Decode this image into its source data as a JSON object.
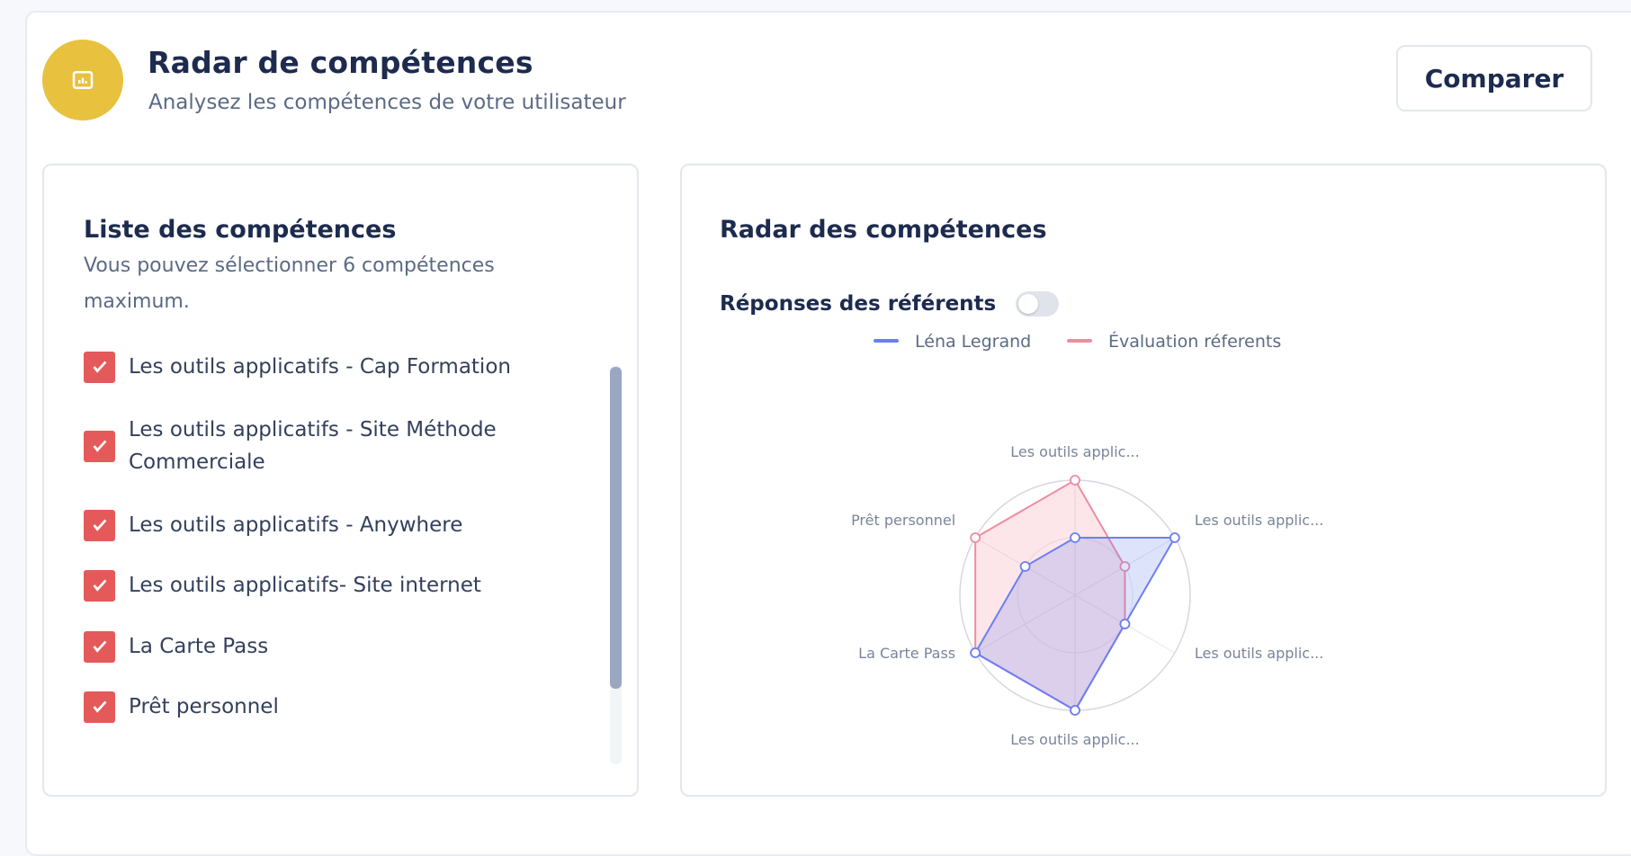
{
  "header": {
    "title": "Radar de compétences",
    "subtitle": "Analysez les compétences de votre utilisateur",
    "compare_label": "Comparer",
    "icon": "chart-icon",
    "icon_color": "#e8c13f"
  },
  "skills_panel": {
    "title": "Liste des compétences",
    "description": "Vous pouvez sélectionner 6 compétences maximum.",
    "items": [
      {
        "label": "Les outils applicatifs - Cap Formation",
        "checked": true
      },
      {
        "label": "Les outils applicatifs - Site Méthode Commerciale",
        "checked": true
      },
      {
        "label": "Les outils applicatifs - Anywhere",
        "checked": true
      },
      {
        "label": "Les outils applicatifs- Site internet",
        "checked": true
      },
      {
        "label": "La Carte Pass",
        "checked": true
      },
      {
        "label": "Prêt personnel",
        "checked": true
      }
    ],
    "checkbox_color": "#e45a5a"
  },
  "radar_panel": {
    "title": "Radar des compétences",
    "toggle_label": "Réponses des référents",
    "toggle_on": false
  },
  "chart_data": {
    "type": "radar",
    "axes": [
      "Les outils applic...",
      "Les outils applic...",
      "Les outils applic...",
      "Les outils applic...",
      "La Carte Pass",
      "Prêt personnel"
    ],
    "max": 5,
    "grid": true,
    "legend_position": "top",
    "series": [
      {
        "name": "Léna Legrand",
        "color": "#6b7ff0",
        "values": [
          2.5,
          5,
          2.5,
          5,
          5,
          2.5
        ]
      },
      {
        "name": "Évaluation réferents",
        "color": "#f08ca0",
        "values": [
          5,
          2.5,
          2.5,
          5,
          5,
          5
        ]
      }
    ]
  }
}
